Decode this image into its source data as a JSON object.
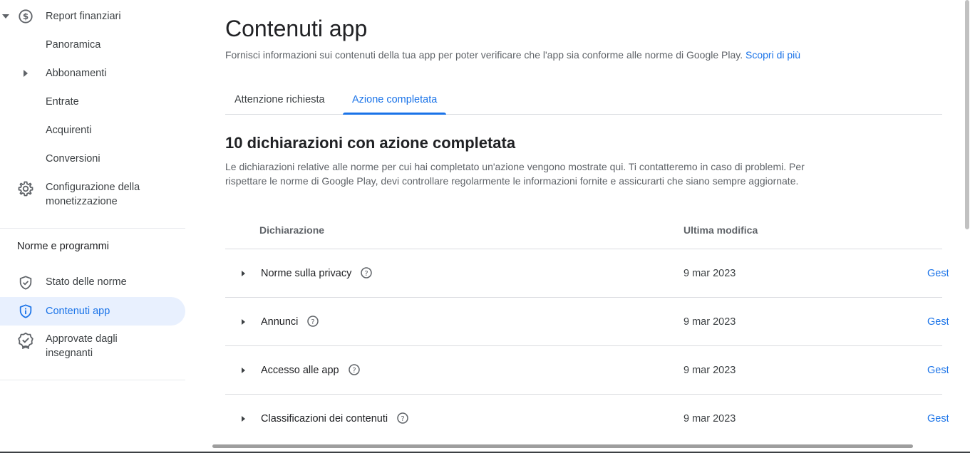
{
  "sidebar": {
    "monetization": {
      "financial_reports": "Report finanziari",
      "overview": "Panoramica",
      "subscriptions": "Abbonamenti",
      "revenue": "Entrate",
      "buyers": "Acquirenti",
      "conversions": "Conversioni",
      "monetization_setup_line1": "Configurazione della",
      "monetization_setup_line2": "monetizzazione"
    },
    "policy_section": {
      "title": "Norme e programmi",
      "policy_status": "Stato delle norme",
      "app_content": "Contenuti app",
      "teacher_approved_line1": "Approvate dagli",
      "teacher_approved_line2": "insegnanti"
    }
  },
  "header": {
    "title": "Contenuti app",
    "subtitle": "Fornisci informazioni sui contenuti della tua app per poter verificare che l'app sia conforme alle norme di Google Play.",
    "learn_more": "Scopri di più"
  },
  "tabs": [
    {
      "label": "Attenzione richiesta",
      "selected": false
    },
    {
      "label": "Azione completata",
      "selected": true
    }
  ],
  "section": {
    "title": "10 dichiarazioni con azione completata",
    "description_line1": "Le dichiarazioni relative alle norme per cui hai completato un'azione vengono mostrate qui. Ti contatteremo in caso di problemi. Per",
    "description_line2": "rispettare le norme di Google Play, devi controllare regolarmente le informazioni fornite e assicurarti che siano sempre aggiornate."
  },
  "table": {
    "col_declaration": "Dichiarazione",
    "col_last_modified": "Ultima modifica",
    "rows": [
      {
        "name": "Norme sulla privacy",
        "date": "9 mar 2023",
        "action": "Gestisci"
      },
      {
        "name": "Annunci",
        "date": "9 mar 2023",
        "action": "Gestisci"
      },
      {
        "name": "Accesso alle app",
        "date": "9 mar 2023",
        "action": "Gestisci"
      },
      {
        "name": "Classificazioni dei contenuti",
        "date": "9 mar 2023",
        "action": "Gestisci"
      }
    ]
  },
  "colors": {
    "accent": "#1a73e8",
    "active_bg": "#e8f0fe",
    "divider": "#dadce0"
  }
}
